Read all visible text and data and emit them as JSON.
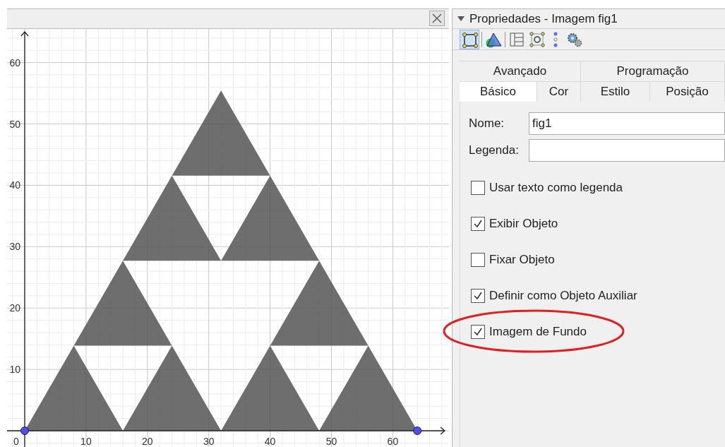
{
  "graphics_view": {
    "x_labels": [
      "0",
      "10",
      "20",
      "30",
      "40",
      "50",
      "60"
    ],
    "y_labels": [
      "60",
      "50",
      "40",
      "30",
      "20",
      "10"
    ]
  },
  "properties": {
    "title": "Propriedades - Imagem fig1",
    "tab_rows": [
      [
        {
          "label": "Avançado",
          "selected": false
        },
        {
          "label": "Programação",
          "selected": false
        }
      ],
      [
        {
          "label": "Básico",
          "selected": true
        },
        {
          "label": "Cor",
          "selected": false
        },
        {
          "label": "Estilo",
          "selected": false
        },
        {
          "label": "Posição",
          "selected": false
        }
      ]
    ],
    "fields": [
      {
        "label": "Nome:",
        "value": "fig1"
      },
      {
        "label": "Legenda:"
      }
    ],
    "checkboxes": [
      {
        "label": "Usar texto como legenda",
        "checked": false,
        "circled": false
      },
      {
        "label": "Exibir Objeto",
        "checked": true,
        "circled": false
      },
      {
        "label": "Fixar Objeto",
        "checked": false,
        "circled": false
      },
      {
        "label": "Definir como Objeto Auxiliar",
        "checked": true,
        "circled": false
      },
      {
        "label": "Imagem de Fundo",
        "checked": true,
        "circled": true
      }
    ]
  }
}
